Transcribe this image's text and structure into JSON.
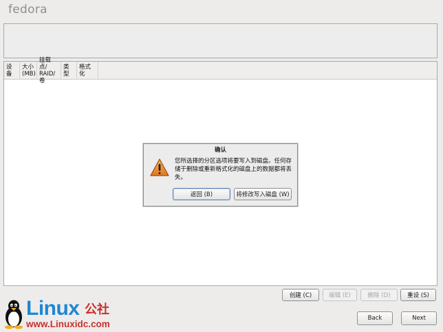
{
  "app": {
    "logo_text": "fedora"
  },
  "partition_table": {
    "columns": [
      {
        "label": "设备"
      },
      {
        "label_line1": "大小",
        "label_line2": "(MB)"
      },
      {
        "label_line1": "挂载点/",
        "label_line2": "RAID/卷"
      },
      {
        "label": "类型"
      },
      {
        "label": "格式化"
      }
    ]
  },
  "dialog": {
    "title": "确认",
    "icon": "warning-triangle-icon",
    "message": "您所选择的分区选项将要写入到磁盘。任何存储于删除或重新格式化的磁盘上的数据都将丢失。",
    "back_label": "返回 (B)",
    "write_label": "将修改写入磁盘 (W)"
  },
  "actions": {
    "create_label": "创建 (C)",
    "edit_label": "编辑 (E)",
    "delete_label": "删除 (D)",
    "reset_label": "重设 (S)"
  },
  "nav": {
    "back_label": "Back",
    "next_label": "Next"
  },
  "watermark": {
    "linux": "Linux",
    "gongshe": "公社",
    "url": "www.Linuxidc.com"
  },
  "colors": {
    "background": "#edeceb",
    "warning": "#e8892b",
    "watermark_blue": "#1e87d0",
    "watermark_red": "#c9302c"
  }
}
